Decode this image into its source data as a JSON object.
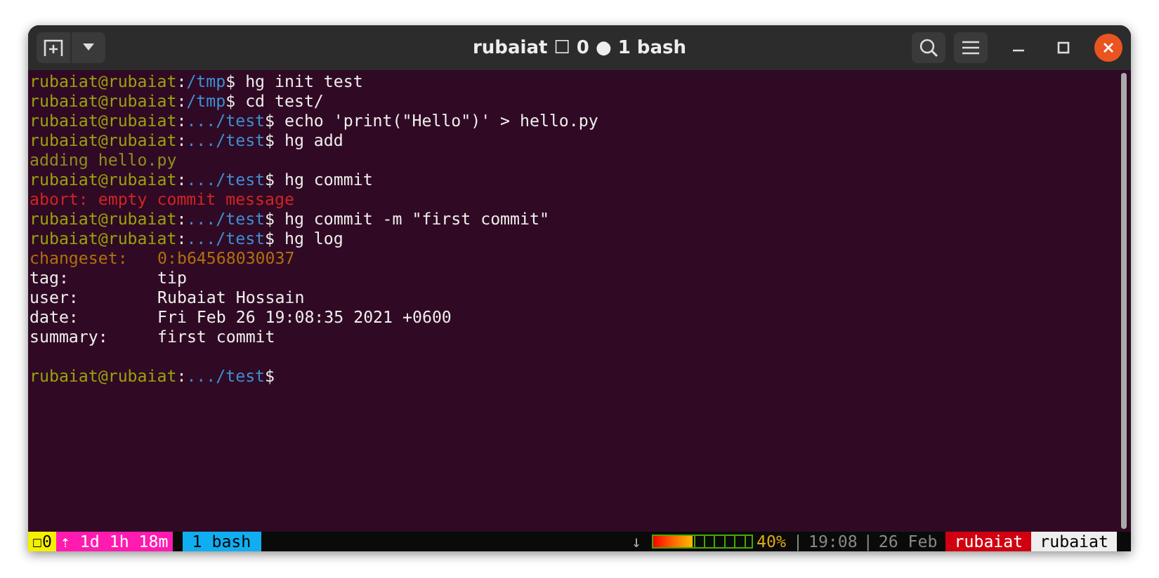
{
  "window": {
    "title": "rubaiat ☐ 0 ● 1 bash"
  },
  "terminal": {
    "lines": [
      {
        "kind": "prompt",
        "user": "rubaiat@rubaiat",
        "separator": ":",
        "path": "/tmp",
        "symbol": "$",
        "command": " hg init test"
      },
      {
        "kind": "prompt",
        "user": "rubaiat@rubaiat",
        "separator": ":",
        "path": "/tmp",
        "symbol": "$",
        "command": " cd test/"
      },
      {
        "kind": "prompt",
        "user": "rubaiat@rubaiat",
        "separator": ":",
        "path": ".../test",
        "symbol": "$",
        "command": " echo 'print(\"Hello\")' > hello.py"
      },
      {
        "kind": "prompt",
        "user": "rubaiat@rubaiat",
        "separator": ":",
        "path": ".../test",
        "symbol": "$",
        "command": " hg add"
      },
      {
        "kind": "output",
        "color": "#8f8f1e",
        "text": "adding hello.py"
      },
      {
        "kind": "prompt",
        "user": "rubaiat@rubaiat",
        "separator": ":",
        "path": ".../test",
        "symbol": "$",
        "command": " hg commit"
      },
      {
        "kind": "output",
        "color": "#d02525",
        "text": "abort: empty commit message"
      },
      {
        "kind": "prompt",
        "user": "rubaiat@rubaiat",
        "separator": ":",
        "path": ".../test",
        "symbol": "$",
        "command": " hg commit -m \"first commit\""
      },
      {
        "kind": "prompt",
        "user": "rubaiat@rubaiat",
        "separator": ":",
        "path": ".../test",
        "symbol": "$",
        "command": " hg log"
      },
      {
        "kind": "field",
        "color": "#b0700f",
        "label": "changeset:",
        "value": "0:b64568030037"
      },
      {
        "kind": "field",
        "color": "#eeeeec",
        "label": "tag:",
        "value": "tip"
      },
      {
        "kind": "field",
        "color": "#eeeeec",
        "label": "user:",
        "value": "Rubaiat Hossain"
      },
      {
        "kind": "field",
        "color": "#eeeeec",
        "label": "date:",
        "value": "Fri Feb 26 19:08:35 2021 +0600"
      },
      {
        "kind": "field",
        "color": "#eeeeec",
        "label": "summary:",
        "value": "first commit"
      },
      {
        "kind": "blank"
      },
      {
        "kind": "prompt",
        "user": "rubaiat@rubaiat",
        "separator": ":",
        "path": ".../test",
        "symbol": "$"
      }
    ]
  },
  "status_bar": {
    "left": [
      {
        "kind": "session",
        "text": "☐0"
      },
      {
        "kind": "uptime",
        "text": "⇡ 1d 1h 18m"
      },
      {
        "kind": "window",
        "text": "1 bash"
      }
    ],
    "right": [
      {
        "kind": "arrow",
        "text": "↓"
      },
      {
        "kind": "battery",
        "level": 0.4
      },
      {
        "kind": "percent",
        "text": "40%"
      },
      {
        "kind": "sep",
        "text": "|"
      },
      {
        "kind": "info",
        "text": "19:08"
      },
      {
        "kind": "sep",
        "text": "|"
      },
      {
        "kind": "info",
        "text": "26 Feb"
      },
      {
        "kind": "user",
        "text": "rubaiat"
      },
      {
        "kind": "host",
        "text": "rubaiat"
      }
    ]
  }
}
